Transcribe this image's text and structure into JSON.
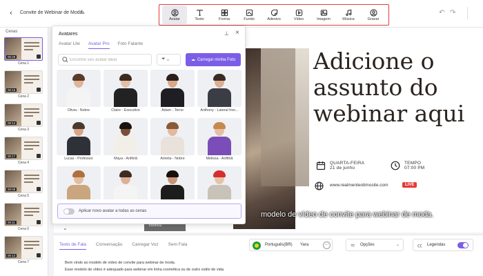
{
  "header": {
    "title": "Convite de Webinar de Moda",
    "tools": [
      {
        "label": "Avatar",
        "icon": "avatar-icon",
        "active": true
      },
      {
        "label": "Texto",
        "icon": "text-icon"
      },
      {
        "label": "Forma",
        "icon": "shape-icon"
      },
      {
        "label": "Fundo",
        "icon": "background-icon"
      },
      {
        "label": "Adesivo",
        "icon": "sticker-icon"
      },
      {
        "label": "Vídeo",
        "icon": "video-icon"
      },
      {
        "label": "Imagem",
        "icon": "image-icon"
      },
      {
        "label": "Música",
        "icon": "music-icon"
      },
      {
        "label": "Gravar",
        "icon": "record-icon"
      }
    ]
  },
  "scenes": {
    "title": "Cenas",
    "items": [
      {
        "label": "Cena 1",
        "duration": "00:29"
      },
      {
        "label": "Cena 2",
        "duration": "00:16"
      },
      {
        "label": "Cena 3",
        "duration": "00:14"
      },
      {
        "label": "Cena 4",
        "duration": "00:17"
      },
      {
        "label": "Cena 5",
        "duration": "00:09"
      },
      {
        "label": "Cena 6",
        "duration": "00:11"
      },
      {
        "label": "Cena 7",
        "duration": "00:13"
      }
    ]
  },
  "canvas": {
    "headline": "Adicione o assunto do webinar aqui",
    "day": "QUARTA-FEIRA",
    "date": "21 de junho",
    "time_label": "TEMPO",
    "time": "07:00 PM",
    "url": "www.realmenteotimosite.com",
    "live": "LIVE",
    "caption": "modelo de vídeo de convite para webinar de moda.",
    "overlay_label": "Vieinoz"
  },
  "avatars": {
    "title": "Avatares",
    "tabs": [
      "Avatar Lite",
      "Avatar Pro",
      "Foto Falante"
    ],
    "active_tab": 1,
    "search_placeholder": "Encontre seu avatar ideal",
    "upload_label": "Carregar minha Foto",
    "apply_label": "Aplicar novo avatar a todas as cenas",
    "apply_on": false,
    "items": [
      {
        "name": "Olivia - Nobre",
        "skin": "#e0b49a",
        "hair": "#5a3a28",
        "outfit": "#f4f4f4"
      },
      {
        "name": "Claire - Executivo",
        "skin": "#e5bfa5",
        "hair": "#3b2a20",
        "outfit": "#222222"
      },
      {
        "name": "Adam - Terno",
        "skin": "#d9a88a",
        "hair": "#2b2018",
        "outfit": "#1e1e24"
      },
      {
        "name": "Anthony - Lateral fron...",
        "skin": "#dcae90",
        "hair": "#3a2c22",
        "outfit": "#3a3d44"
      },
      {
        "name": "Lucas - Professor",
        "skin": "#d7a486",
        "hair": "#4a3a2e",
        "outfit": "#2e3138"
      },
      {
        "name": "Maya - Anfitriã",
        "skin": "#7a4f36",
        "hair": "#1a120d",
        "outfit": "#f2efe8"
      },
      {
        "name": "Amelia - Nobre",
        "skin": "#e3b89c",
        "hair": "#8a5a38",
        "outfit": "#e8e2da"
      },
      {
        "name": "Melissa - Anfitriã",
        "skin": "#e6c0a4",
        "hair": "#c48a4e",
        "outfit": "#7b4db8"
      },
      {
        "name": "",
        "skin": "#e4bc9f",
        "hair": "#b0703e",
        "outfit": "#c9a67e"
      },
      {
        "name": "",
        "skin": "#ddb095",
        "hair": "#3e2c22",
        "outfit": "#f4f4f4"
      },
      {
        "name": "",
        "skin": "#c99478",
        "hair": "#15100c",
        "outfit": "#1c1c1c"
      },
      {
        "name": "",
        "skin": "#e6c4a8",
        "hair": "#d32f2f",
        "outfit": "#c8c2b8"
      }
    ]
  },
  "script": {
    "tabs": [
      "Texto de Fala",
      "Conversação",
      "Carregar Voz",
      "Sem Fala"
    ],
    "active_tab": 0,
    "language": "Português(BR)",
    "voice": "Yara",
    "options_label": "Opções",
    "legend_label": "Legendas",
    "legend_on": true,
    "lines": [
      "Bem vindo ao modelo de vídeo de convite para webinar de moda.",
      "Esse modelo de vídeo é adequado para webinar em linha cosmética ou de outro estilo de vida."
    ]
  },
  "colors": {
    "accent": "#7b5ee6",
    "live": "#e53935",
    "highlight_border": "#e23b3b"
  }
}
